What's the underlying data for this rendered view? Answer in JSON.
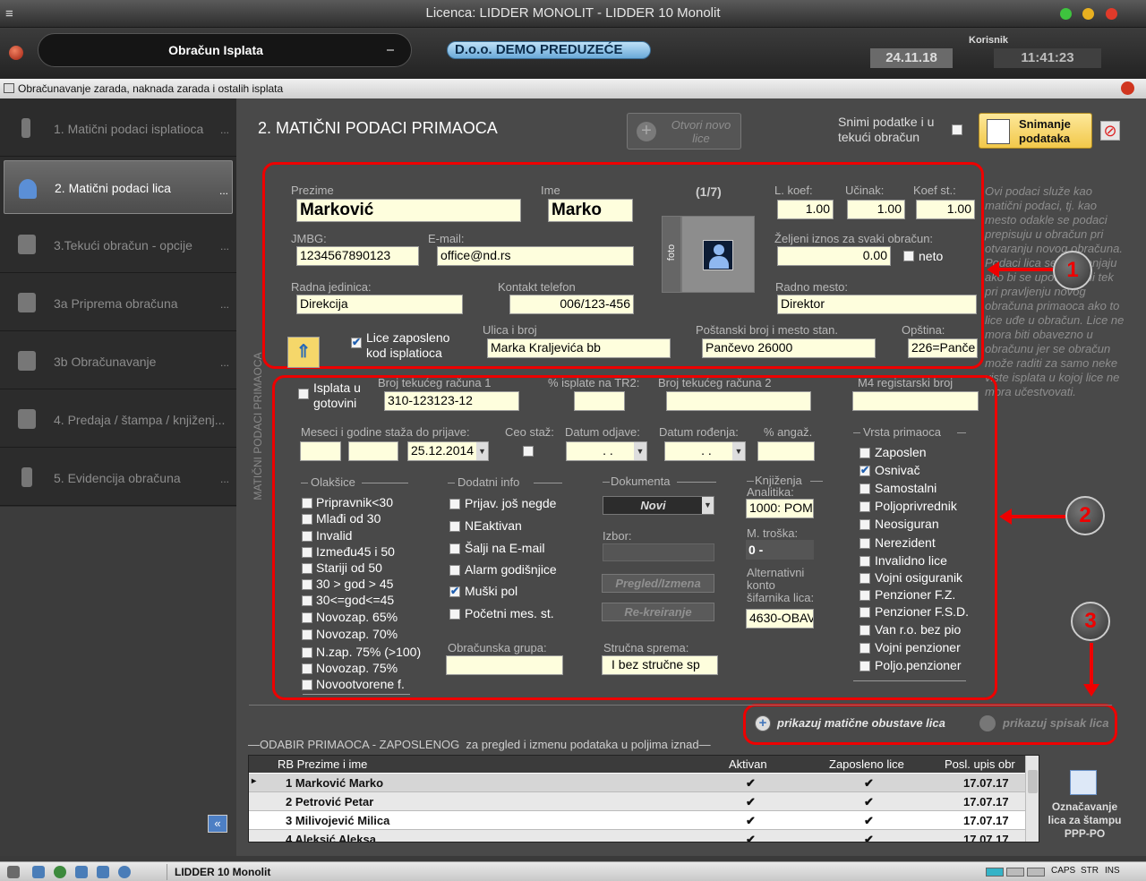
{
  "window": {
    "title": "Licenca: LIDDER MONOLIT - LIDDER 10 Monolit"
  },
  "toolbar": {
    "module": "Obračun Isplata",
    "company": "D.o.o. DEMO PREDUZEĆE",
    "user_label": "Korisnik",
    "date": "24.11.18",
    "time": "11:41:23"
  },
  "subwindow": {
    "title": "Obračunavanje zarada, naknada zarada i ostalih isplata"
  },
  "sidebar": {
    "items": [
      {
        "label": "1. Matični podaci isplatioca",
        "dots": "..."
      },
      {
        "label": "2. Matični podaci lica",
        "dots": "..."
      },
      {
        "label": "3.Tekući obračun - opcije",
        "dots": "..."
      },
      {
        "label": "3a Priprema obračuna",
        "dots": "..."
      },
      {
        "label": "3b Obračunavanje",
        "dots": "..."
      },
      {
        "label": "4. Predaja / štampa / knjiženj...",
        "dots": ""
      },
      {
        "label": "5. Evidencija obračuna",
        "dots": "..."
      }
    ]
  },
  "header": {
    "title": "2. MATIČNI PODACI PRIMAOCA",
    "open_new": "Otvori novo lice",
    "save_note": "Snimi podatke i u tekući obračun",
    "save_button": "Snimanje podataka",
    "side_label": "MATIČNI PODACI PRIMAOCA"
  },
  "person": {
    "prezime_label": "Prezime",
    "prezime": "Marković",
    "ime_label": "Ime",
    "ime": "Marko",
    "counter": "(1/7)",
    "foto_label": "foto",
    "jmbg_label": "JMBG:",
    "jmbg": "1234567890123",
    "email_label": "E-mail:",
    "email": "office@nd.rs",
    "radna_jedinica_label": "Radna jedinica:",
    "radna_jedinica": "Direkcija",
    "telefon_label": "Kontakt telefon",
    "telefon": "006/123-456",
    "lkoef_label": "L. koef:",
    "lkoef": "1.00",
    "ucinak_label": "Učinak:",
    "ucinak": "1.00",
    "koefst_label": "Koef st.:",
    "koefst": "1.00",
    "zeljeni_label": "Željeni iznos za svaki obračun:",
    "zeljeni": "0.00",
    "neto_label": "neto",
    "radno_mesto_label": "Radno mesto:",
    "radno_mesto": "Direktor",
    "lice_zaposleno_label": "Lice zaposleno kod isplatioca",
    "ulica_label": "Ulica i broj",
    "ulica": "Marka Kraljevića bb",
    "postanski_label": "Poštanski broj i mesto stan.",
    "postanski": "Pančevo 26000",
    "opstina_label": "Opština:",
    "opstina": "226=Panče"
  },
  "account": {
    "gotovini_label": "Isplata u gotovini",
    "tr1_label": "Broj tekućeg računa 1",
    "tr1": "310-123123-12",
    "pct_label": "% isplate na TR2:",
    "pct": "",
    "tr2_label": "Broj tekućeg računa 2",
    "tr2": "",
    "m4_label": "M4 registarski broj",
    "m4": "",
    "staz_label": "Meseci  i  godine staža do prijave:",
    "datum_staza": "25.12.2014",
    "ceo_staz_label": "Ceo staž:",
    "datum_odjave_label": "Datum odjave:",
    "datum_odjave": " .  .",
    "datum_rodjenja_label": "Datum rođenja:",
    "datum_rodjenja": " .  .",
    "angaz_label": "% angaž.",
    "angaz": ""
  },
  "olaksice": {
    "title": "Olakšice",
    "items": [
      "Pripravnik<30",
      "Mlađi od 30",
      "Invalid",
      "Između45 i 50",
      "Stariji od 50",
      "30 > god > 45",
      "30<=god<=45",
      "Novozap. 65%",
      "Novozap. 70%",
      "N.zap. 75% (>100)",
      "Novozap. 75%",
      "Novootvorene f."
    ]
  },
  "dodatni": {
    "title": "Dodatni info",
    "items": [
      "Prijav. još negde",
      "NEaktivan",
      "Šalji na E-mail",
      "Alarm godišnjice",
      "Muški pol",
      "Početni mes. st."
    ],
    "checked": [
      false,
      false,
      false,
      false,
      true,
      false
    ]
  },
  "grupa": {
    "label": "Obračunska grupa:",
    "value": ""
  },
  "dokumenta": {
    "title": "Dokumenta",
    "select": "Novi",
    "izbor_label": "Izbor:",
    "pregled": "Pregled/Izmena",
    "rekreiranje": "Re-kreiranje"
  },
  "strucna": {
    "label": "Stručna sprema:",
    "value": "I bez stručne sp"
  },
  "knjizenja": {
    "title": "Knjiženja",
    "analitika_label": "Analitika:",
    "analitika": "1000: POM",
    "mtroska_label": "M. troška:",
    "mtroska": "0 -",
    "alt_label": "Alternativni konto šifarnika lica:",
    "alt": "4630-OBAV"
  },
  "vrsta": {
    "title": "Vrsta primaoca",
    "items": [
      "Zaposlen",
      "Osnivač",
      "Samostalni",
      "Poljoprivrednik",
      "Neosiguran",
      "Nerezident",
      "Invalidno lice",
      "Vojni osiguranik",
      "Penzioner F.Z.",
      "Penzioner F.S.D.",
      "Van r.o. bez pio",
      "Vojni penzioner",
      "Poljo.penzioner"
    ],
    "checked": [
      false,
      true,
      false,
      false,
      false,
      false,
      false,
      false,
      false,
      false,
      false,
      false,
      false
    ]
  },
  "help": {
    "text": "Ovi podaci služe kao matični podaci, tj. kao mesto odakle se podaci prepisuju u obračun pri otvaranju novog obračuna. Podaci lica se ne menjaju ako bi se upotrebljeni tek pri pravljenju novog obračuna primaoca ako to lice uđe u obračun. Lice ne mora biti obavezno u obračunu jer se obračun može raditi za samo neke viste isplata u kojoj lice ne mora učestvovati."
  },
  "annotations": {
    "one": "1",
    "two": "2",
    "three": "3"
  },
  "bottom": {
    "obustave": "prikazuj matične obustave lica",
    "spisak": "prikazuj spisak lica",
    "section": "ODABIR PRIMAOCA - ZAPOSLENOG  za pregled i izmenu podataka u poljima iznad"
  },
  "table": {
    "headers": [
      "RB Prezime i ime",
      "Aktivan",
      "Zaposleno lice",
      "Posl. upis obr"
    ],
    "rows": [
      {
        "name": "1 Marković Marko",
        "aktivan": "✔",
        "zaposleno": "✔",
        "upis": "17.07.17"
      },
      {
        "name": "2 Petrović Petar",
        "aktivan": "✔",
        "zaposleno": "✔",
        "upis": "17.07.17"
      },
      {
        "name": "3 Milivojević Milica",
        "aktivan": "✔",
        "zaposleno": "✔",
        "upis": "17.07.17"
      },
      {
        "name": "4 Aleksić Aleksa",
        "aktivan": "✔",
        "zaposleno": "✔",
        "upis": "17.07.17"
      }
    ]
  },
  "ppp": {
    "label": "Označavanje lica za štampu PPP-PO"
  },
  "statusbar": {
    "app": "LIDDER 10 Monolit",
    "caps": "CAPS",
    "str": "STR",
    "ins": "INS"
  },
  "colors": {
    "accent": "#e00000",
    "input_bg": "#fefedd",
    "company": "#6aa9d8"
  }
}
